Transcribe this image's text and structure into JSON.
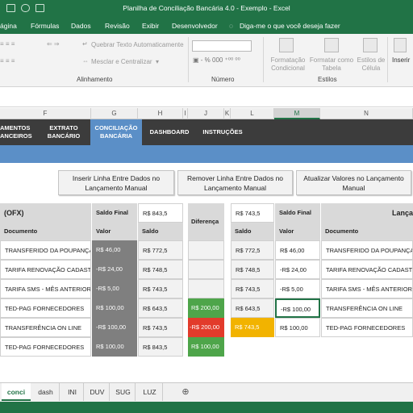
{
  "window": {
    "title": "Planilha de Conciliação Bancária 4.0 - Exemplo - Excel"
  },
  "ribbon_tabs": [
    "ágina",
    "Fórmulas",
    "Dados",
    "Revisão",
    "Exibir",
    "Desenvolvedor",
    "Diga-me o que você deseja fazer"
  ],
  "ribbon": {
    "wrap_text": "Quebrar Texto Automaticamente",
    "merge_center": "Mesclar e Centralizar",
    "group_alignment": "Alinhamento",
    "group_number": "Número",
    "group_styles": "Estilos",
    "cond_format": "Formatação Condicional",
    "format_table": "Formatar como Tabela",
    "cell_styles": "Estilos de Célula",
    "insert": "Inserir"
  },
  "columns": [
    "F",
    "G",
    "H",
    "I",
    "J",
    "K",
    "L",
    "M",
    "N"
  ],
  "nav": {
    "lancamentos": "AMENTOS ANCEIROS",
    "extrato": "EXTRATO BANCÁRIO",
    "conciliacao": "CONCILIAÇÃO BANCÁRIA",
    "dashboard": "DASHBOARD",
    "instrucoes": "INSTRUÇÕES"
  },
  "buttons": {
    "insert_row": "Inserir Linha Entre Dados no Lançamento Manual",
    "remove_row": "Remover Linha Entre Dados no Lançamento Manual",
    "update_values": "Atualizar Valores no Lançamento Manual"
  },
  "ofx": {
    "title": "(OFX)",
    "saldo_final_label": "Saldo Final",
    "saldo_final": "R$ 843,5",
    "col_doc": "Documento",
    "col_valor": "Valor",
    "col_saldo": "Saldo",
    "rows": [
      {
        "doc": "TRANSFERIDO DA POUPANÇA",
        "valor": "R$ 46,00",
        "saldo": "R$ 772,5"
      },
      {
        "doc": "TARIFA RENOVAÇÃO CADASTRO",
        "valor": "-R$ 24,00",
        "saldo": "R$ 748,5"
      },
      {
        "doc": "TARIFA SMS - MÊS ANTERIOR",
        "valor": "-R$ 5,00",
        "saldo": "R$ 743,5"
      },
      {
        "doc": "TED-PAG FORNECEDORES",
        "valor": "R$ 100,00",
        "saldo": "R$ 643,5"
      },
      {
        "doc": "TRANSFERÊNCIA ON LINE",
        "valor": "-R$ 100,00",
        "saldo": "R$ 743,5"
      },
      {
        "doc": "TED-PAG FORNECEDORES",
        "valor": "R$ 100,00",
        "saldo": "R$ 843,5"
      }
    ]
  },
  "diff": {
    "label": "Diferença",
    "rows": [
      "",
      "",
      "",
      "R$ 200,00",
      "-R$ 200,00",
      "R$ 100,00"
    ]
  },
  "manual": {
    "saldo_top": "R$ 743,5",
    "saldo_final_label": "Saldo Final",
    "title": "Lança",
    "col_saldo": "Saldo",
    "col_valor": "Valor",
    "col_doc": "Documento",
    "rows": [
      {
        "saldo": "R$ 772,5",
        "valor": "R$ 46,00",
        "doc": "TRANSFERIDO DA POUPANÇA"
      },
      {
        "saldo": "R$ 748,5",
        "valor": "-R$ 24,00",
        "doc": "TARIFA RENOVAÇÃO CADASTRO"
      },
      {
        "saldo": "R$ 743,5",
        "valor": "-R$ 5,00",
        "doc": "TARIFA SMS - MÊS ANTERIOR"
      },
      {
        "saldo": "R$ 643,5",
        "valor": "-R$ 100,00",
        "doc": "TRANSFERÊNCIA ON LINE"
      },
      {
        "saldo": "R$ 743,5",
        "valor": "R$ 100,00",
        "doc": "TED-PAG FORNECEDORES"
      }
    ]
  },
  "sheet_tabs": [
    "conci",
    "dash",
    "INI",
    "DUV",
    "SUG",
    "LUZ"
  ],
  "colors": {
    "excel_green": "#217346",
    "nav_dark": "#3c3c3c",
    "nav_blue": "#5b8fc7",
    "green": "#4ea54a",
    "red": "#e23b2b",
    "yellow": "#f2b300"
  }
}
